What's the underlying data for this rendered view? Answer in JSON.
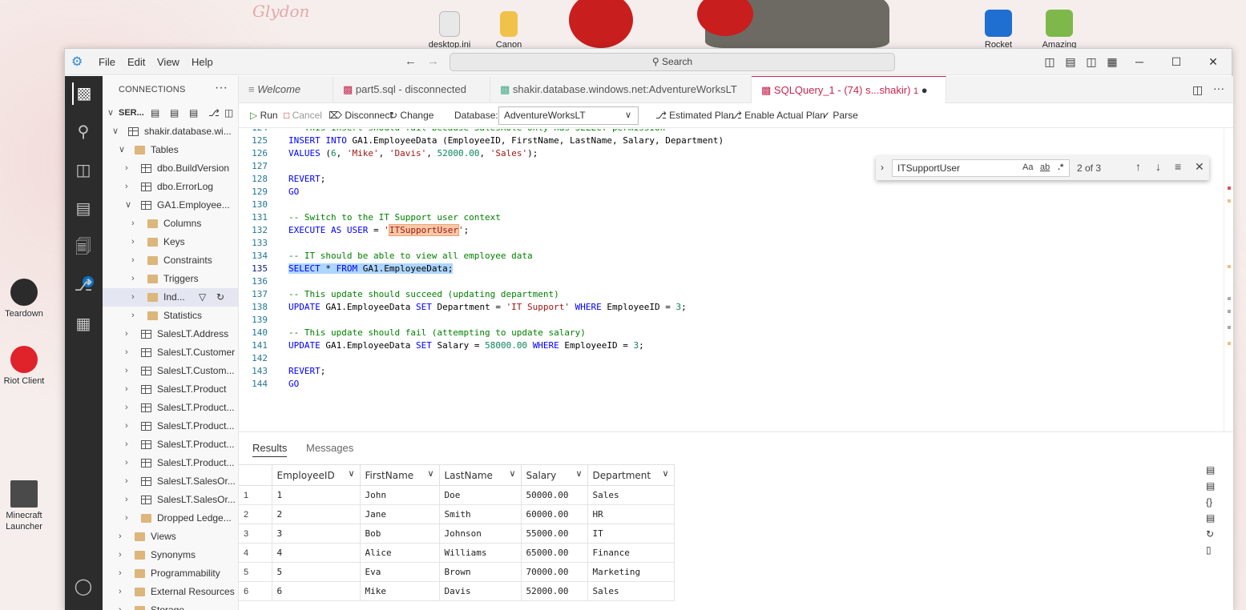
{
  "desktop": {
    "icons": [
      {
        "label": "desktop.ini"
      },
      {
        "label": "Canon"
      },
      {
        "label": "Rocket"
      },
      {
        "label": "Amazing"
      },
      {
        "label": "Teardown"
      },
      {
        "label": "Riot Client"
      },
      {
        "label": "Minecraft Launcher"
      }
    ],
    "wallpaper_text": "Glydon"
  },
  "window": {
    "menu": [
      "File",
      "Edit",
      "View",
      "Help"
    ],
    "search_placeholder": "Search",
    "controls": {
      "minimize": "─",
      "maximize": "☐",
      "close": "✕"
    }
  },
  "sidebar": {
    "header": "CONNECTIONS",
    "more": "···",
    "server_label": "SER...",
    "tree": [
      {
        "label": "shakir.database.wi...",
        "level": 1,
        "type": "server",
        "expanded": true
      },
      {
        "label": "Tables",
        "level": 2,
        "type": "folder",
        "expanded": true
      },
      {
        "label": "dbo.BuildVersion",
        "level": 3,
        "type": "table"
      },
      {
        "label": "dbo.ErrorLog",
        "level": 3,
        "type": "table"
      },
      {
        "label": "GA1.Employee...",
        "level": 3,
        "type": "table",
        "expanded": true
      },
      {
        "label": "Columns",
        "level": 4,
        "type": "folder"
      },
      {
        "label": "Keys",
        "level": 4,
        "type": "folder"
      },
      {
        "label": "Constraints",
        "level": 4,
        "type": "folder"
      },
      {
        "label": "Triggers",
        "level": 4,
        "type": "folder"
      },
      {
        "label": "Ind...",
        "level": 4,
        "type": "folder",
        "selected": true
      },
      {
        "label": "Statistics",
        "level": 4,
        "type": "folder"
      },
      {
        "label": "SalesLT.Address",
        "level": 3,
        "type": "table"
      },
      {
        "label": "SalesLT.Customer",
        "level": 3,
        "type": "table"
      },
      {
        "label": "SalesLT.Custom...",
        "level": 3,
        "type": "table"
      },
      {
        "label": "SalesLT.Product",
        "level": 3,
        "type": "table"
      },
      {
        "label": "SalesLT.Product...",
        "level": 3,
        "type": "table"
      },
      {
        "label": "SalesLT.Product...",
        "level": 3,
        "type": "table"
      },
      {
        "label": "SalesLT.Product...",
        "level": 3,
        "type": "table"
      },
      {
        "label": "SalesLT.Product...",
        "level": 3,
        "type": "table"
      },
      {
        "label": "SalesLT.SalesOr...",
        "level": 3,
        "type": "table"
      },
      {
        "label": "SalesLT.SalesOr...",
        "level": 3,
        "type": "table"
      },
      {
        "label": "Dropped Ledge...",
        "level": 3,
        "type": "folder"
      },
      {
        "label": "Views",
        "level": 2,
        "type": "folder"
      },
      {
        "label": "Synonyms",
        "level": 2,
        "type": "folder"
      },
      {
        "label": "Programmability",
        "level": 2,
        "type": "folder"
      },
      {
        "label": "External Resources",
        "level": 2,
        "type": "folder"
      },
      {
        "label": "Storage",
        "level": 2,
        "type": "folder"
      }
    ],
    "activity_badge": "1"
  },
  "tabs": [
    {
      "label": "Welcome"
    },
    {
      "label": "part5.sql - disconnected"
    },
    {
      "label": "shakir.database.windows.net:AdventureWorksLT"
    },
    {
      "label": "SQLQuery_1 - (74) s...shakir)",
      "badge": "1",
      "active": true
    }
  ],
  "toolbar": {
    "run": "Run",
    "cancel": "Cancel",
    "disconnect": "Disconnect",
    "change": "Change",
    "database_label": "Database:",
    "database_value": "AdventureWorksLT",
    "estimated_plan": "Estimated Plan",
    "actual_plan": "Enable Actual Plan",
    "parse": "Parse"
  },
  "find": {
    "query": "ITSupportUser",
    "match_case": "Aa",
    "whole_word": "ab",
    "regex": ".*",
    "count": "2 of 3"
  },
  "code": {
    "lines": [
      {
        "n": "124",
        "text": "-- This insert should fail because SalesRole only has SELECT permission",
        "cls": "cm"
      },
      {
        "n": "125",
        "html": "<span class=\"kw\">INSERT INTO</span> GA1.EmployeeData (EmployeeID, FirstName, LastName, Salary, Department)"
      },
      {
        "n": "126",
        "html": "<span class=\"kw\">VALUES</span> (<span class=\"num\">6</span>, <span class=\"str\">'Mike'</span>, <span class=\"str\">'Davis'</span>, <span class=\"num\">52000.00</span>, <span class=\"str\">'Sales'</span>);"
      },
      {
        "n": "127",
        "text": ""
      },
      {
        "n": "128",
        "html": "<span class=\"kw\">REVERT</span>;"
      },
      {
        "n": "129",
        "html": "<span class=\"kw\">GO</span>"
      },
      {
        "n": "130",
        "text": ""
      },
      {
        "n": "131",
        "text": "-- Switch to the IT Support user context",
        "cls": "cm"
      },
      {
        "n": "132",
        "html": "<span class=\"kw\">EXECUTE AS USER</span> = <span class=\"str\">'<span class=\"hl\">ITSupportUser</span>'</span>;"
      },
      {
        "n": "133",
        "text": ""
      },
      {
        "n": "134",
        "text": "-- IT should be able to view all employee data",
        "cls": "cm"
      },
      {
        "n": "135",
        "html": "<span class=\"selh\"><span class=\"kw\">SELECT</span> * <span class=\"kw\">FROM</span> GA1.EmployeeData;</span>",
        "cur": true
      },
      {
        "n": "136",
        "text": ""
      },
      {
        "n": "137",
        "text": "-- This update should succeed (updating department)",
        "cls": "cm"
      },
      {
        "n": "138",
        "html": "<span class=\"kw\">UPDATE</span> GA1.EmployeeData <span class=\"kw\">SET</span> Department = <span class=\"str\">'IT Support'</span> <span class=\"kw\">WHERE</span> EmployeeID = <span class=\"num\">3</span>;"
      },
      {
        "n": "139",
        "text": ""
      },
      {
        "n": "140",
        "text": "-- This update should fail (attempting to update salary)",
        "cls": "cm"
      },
      {
        "n": "141",
        "html": "<span class=\"kw\">UPDATE</span> GA1.EmployeeData <span class=\"kw\">SET</span> Salary = <span class=\"num\">58000.00</span> <span class=\"kw\">WHERE</span> EmployeeID = <span class=\"num\">3</span>;"
      },
      {
        "n": "142",
        "text": ""
      },
      {
        "n": "143",
        "html": "<span class=\"kw\">REVERT</span>;"
      },
      {
        "n": "144",
        "html": "<span class=\"kw\">GO</span>"
      }
    ]
  },
  "results": {
    "tabs": [
      "Results",
      "Messages"
    ],
    "columns": [
      "EmployeeID",
      "FirstName",
      "LastName",
      "Salary",
      "Department"
    ],
    "rows": [
      [
        "1",
        "1",
        "John",
        "Doe",
        "50000.00",
        "Sales"
      ],
      [
        "2",
        "2",
        "Jane",
        "Smith",
        "60000.00",
        "HR"
      ],
      [
        "3",
        "3",
        "Bob",
        "Johnson",
        "55000.00",
        "IT"
      ],
      [
        "4",
        "4",
        "Alice",
        "Williams",
        "65000.00",
        "Finance"
      ],
      [
        "5",
        "5",
        "Eva",
        "Brown",
        "70000.00",
        "Marketing"
      ],
      [
        "6",
        "6",
        "Mike",
        "Davis",
        "52000.00",
        "Sales"
      ]
    ]
  }
}
